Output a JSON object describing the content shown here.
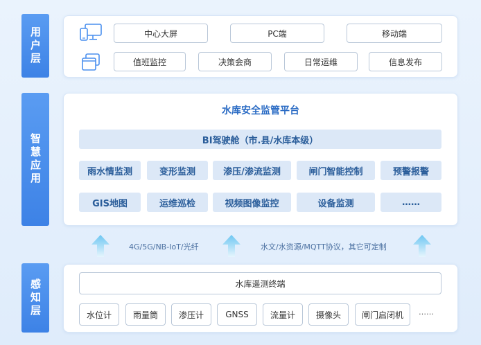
{
  "layers": {
    "user": "用户层",
    "app": "智慧应用",
    "sense": "感知层"
  },
  "user_layer": {
    "icons": [
      "monitor-phone-icon",
      "windows-stack-icon"
    ],
    "row1": [
      "中心大屏",
      "PC端",
      "移动端"
    ],
    "row2": [
      "值班监控",
      "决策会商",
      "日常运维",
      "信息发布"
    ]
  },
  "app_layer": {
    "title": "水库安全监管平台",
    "cockpit": "BI驾驶舱（市.县/水库本级）",
    "modules_row1": [
      "雨水情监测",
      "变形监测",
      "渗压/渗流监测",
      "闸门智能控制",
      "预警报警"
    ],
    "modules_row2": [
      "GIS地图",
      "运维巡检",
      "视频图像监控",
      "设备监测",
      "……"
    ]
  },
  "transport": {
    "left_label": "4G/5G/NB-IoT/光纤",
    "right_label": "水文/水资源/MQTT协议，其它可定制",
    "arrow_color": "#8fd3f5"
  },
  "sense_layer": {
    "terminal": "水库遥测终端",
    "devices": [
      "水位计",
      "雨量筒",
      "渗压计",
      "GNSS",
      "流量计",
      "摄像头",
      "闸门启闭机",
      "……"
    ]
  },
  "colors": {
    "tab": "#4a8fee",
    "title": "#2a6bc4",
    "module_bg": "#dce8f7",
    "module_text": "#2a5d9a"
  }
}
